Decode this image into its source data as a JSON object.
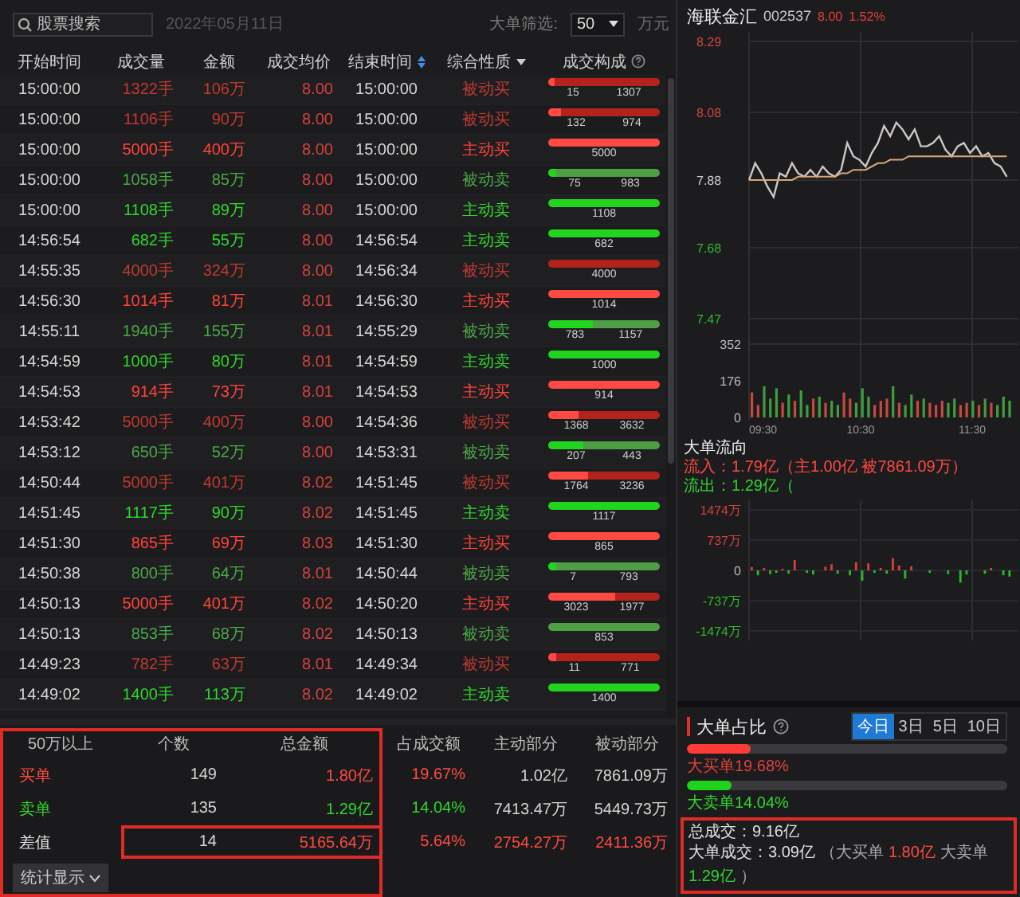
{
  "toolbar": {
    "search": {
      "placeholder": "股票搜索"
    },
    "date": "2022年05月11日",
    "filter_label": "大单筛选:",
    "filter_value": "50",
    "filter_unit": "万元"
  },
  "table": {
    "columns": [
      {
        "label": "开始时间",
        "sortable": false,
        "filter": false,
        "help": false
      },
      {
        "label": "成交量",
        "sortable": false,
        "filter": false,
        "help": false
      },
      {
        "label": "金额",
        "sortable": false,
        "filter": false,
        "help": false
      },
      {
        "label": "成交均价",
        "sortable": false,
        "filter": false,
        "help": false
      },
      {
        "label": "结束时间",
        "sortable": true,
        "filter": false,
        "help": false
      },
      {
        "label": "综合性质",
        "sortable": false,
        "filter": true,
        "help": false
      },
      {
        "label": "成交构成",
        "sortable": false,
        "filter": false,
        "help": true
      }
    ],
    "rows": [
      {
        "start": "15:00:00",
        "volume": "1322手",
        "amount": "106万",
        "avg_price": "8.00",
        "end": "15:00:00",
        "nature": "被动买",
        "kind": "buy",
        "active": false,
        "level": 0.06,
        "bar_labels": [
          "15",
          "1307"
        ]
      },
      {
        "start": "15:00:00",
        "volume": "1106手",
        "amount": "90万",
        "avg_price": "8.00",
        "end": "15:00:00",
        "nature": "被动买",
        "kind": "buy",
        "active": false,
        "level": 0.12,
        "bar_labels": [
          "132",
          "974"
        ]
      },
      {
        "start": "15:00:00",
        "volume": "5000手",
        "amount": "400万",
        "avg_price": "8.00",
        "end": "15:00:00",
        "nature": "主动买",
        "kind": "buy",
        "active": true,
        "level": 1,
        "bar_labels": [
          "5000"
        ]
      },
      {
        "start": "15:00:00",
        "volume": "1058手",
        "amount": "85万",
        "avg_price": "8.00",
        "end": "15:00:00",
        "nature": "被动卖",
        "kind": "sell",
        "active": false,
        "level": 0.07,
        "bar_labels": [
          "75",
          "983"
        ]
      },
      {
        "start": "15:00:00",
        "volume": "1108手",
        "amount": "89万",
        "avg_price": "8.00",
        "end": "15:00:00",
        "nature": "主动卖",
        "kind": "sell",
        "active": true,
        "level": 1,
        "bar_labels": [
          "1108"
        ]
      },
      {
        "start": "14:56:54",
        "volume": "682手",
        "amount": "55万",
        "avg_price": "8.00",
        "end": "14:56:54",
        "nature": "主动卖",
        "kind": "sell",
        "active": true,
        "level": 1,
        "bar_labels": [
          "682"
        ]
      },
      {
        "start": "14:55:35",
        "volume": "4000手",
        "amount": "324万",
        "avg_price": "8.00",
        "end": "14:56:34",
        "nature": "被动买",
        "kind": "buy",
        "active": false,
        "level": 0,
        "bar_labels": [
          "4000"
        ]
      },
      {
        "start": "14:56:30",
        "volume": "1014手",
        "amount": "81万",
        "avg_price": "8.01",
        "end": "14:56:30",
        "nature": "主动买",
        "kind": "buy",
        "active": true,
        "level": 1,
        "bar_labels": [
          "1014"
        ]
      },
      {
        "start": "14:55:11",
        "volume": "1940手",
        "amount": "155万",
        "avg_price": "8.01",
        "end": "14:55:29",
        "nature": "被动卖",
        "kind": "sell",
        "active": false,
        "level": 0.4,
        "bar_labels": [
          "783",
          "1157"
        ]
      },
      {
        "start": "14:54:59",
        "volume": "1000手",
        "amount": "80万",
        "avg_price": "8.01",
        "end": "14:54:59",
        "nature": "主动卖",
        "kind": "sell",
        "active": true,
        "level": 1,
        "bar_labels": [
          "1000"
        ]
      },
      {
        "start": "14:54:53",
        "volume": "914手",
        "amount": "73万",
        "avg_price": "8.01",
        "end": "14:54:53",
        "nature": "主动买",
        "kind": "buy",
        "active": true,
        "level": 1,
        "bar_labels": [
          "914"
        ]
      },
      {
        "start": "14:53:42",
        "volume": "5000手",
        "amount": "400万",
        "avg_price": "8.00",
        "end": "14:54:36",
        "nature": "被动买",
        "kind": "buy",
        "active": false,
        "level": 0.27,
        "bar_labels": [
          "1368",
          "3632"
        ]
      },
      {
        "start": "14:53:12",
        "volume": "650手",
        "amount": "52万",
        "avg_price": "8.00",
        "end": "14:53:31",
        "nature": "被动卖",
        "kind": "sell",
        "active": false,
        "level": 0.32,
        "bar_labels": [
          "207",
          "443"
        ]
      },
      {
        "start": "14:50:44",
        "volume": "5000手",
        "amount": "401万",
        "avg_price": "8.02",
        "end": "14:51:45",
        "nature": "被动买",
        "kind": "buy",
        "active": false,
        "level": 0.35,
        "bar_labels": [
          "1764",
          "3236"
        ]
      },
      {
        "start": "14:51:45",
        "volume": "1117手",
        "amount": "90万",
        "avg_price": "8.02",
        "end": "14:51:45",
        "nature": "主动卖",
        "kind": "sell",
        "active": true,
        "level": 1,
        "bar_labels": [
          "1117"
        ]
      },
      {
        "start": "14:51:30",
        "volume": "865手",
        "amount": "69万",
        "avg_price": "8.03",
        "end": "14:51:30",
        "nature": "主动买",
        "kind": "buy",
        "active": true,
        "level": 1,
        "bar_labels": [
          "865"
        ]
      },
      {
        "start": "14:50:38",
        "volume": "800手",
        "amount": "64万",
        "avg_price": "8.01",
        "end": "14:50:44",
        "nature": "被动卖",
        "kind": "sell",
        "active": false,
        "level": 0.07,
        "bar_labels": [
          "7",
          "793"
        ]
      },
      {
        "start": "14:50:13",
        "volume": "5000手",
        "amount": "401万",
        "avg_price": "8.02",
        "end": "14:50:20",
        "nature": "主动买",
        "kind": "buy",
        "active": true,
        "level": 0.6,
        "bar_labels": [
          "3023",
          "1977"
        ]
      },
      {
        "start": "14:50:13",
        "volume": "853手",
        "amount": "68万",
        "avg_price": "8.02",
        "end": "14:50:13",
        "nature": "被动卖",
        "kind": "sell",
        "active": false,
        "level": 0,
        "bar_labels": [
          "853"
        ]
      },
      {
        "start": "14:49:23",
        "volume": "782手",
        "amount": "63万",
        "avg_price": "8.01",
        "end": "14:49:34",
        "nature": "被动买",
        "kind": "buy",
        "active": false,
        "level": 0.07,
        "bar_labels": [
          "11",
          "771"
        ]
      },
      {
        "start": "14:49:02",
        "volume": "1400手",
        "amount": "113万",
        "avg_price": "8.02",
        "end": "14:49:02",
        "nature": "主动卖",
        "kind": "sell",
        "active": true,
        "level": 1,
        "bar_labels": [
          "1400"
        ]
      }
    ]
  },
  "summary": {
    "highlighted": true,
    "columns": [
      "50万以上",
      "个数",
      "总金额",
      "占成交额",
      "主动部分",
      "被动部分"
    ],
    "rows": [
      {
        "kind": "buy",
        "label": "买单",
        "count": "149",
        "total": "1.80亿",
        "share": "19.67%",
        "active": "1.02亿",
        "passive": "7861.09万",
        "highlighted": false
      },
      {
        "kind": "sell",
        "label": "卖单",
        "count": "135",
        "total": "1.29亿",
        "share": "14.04%",
        "active": "7413.47万",
        "passive": "5449.73万",
        "highlighted": false
      },
      {
        "kind": "diff",
        "label": "差值",
        "count": "14",
        "total": "5165.64万",
        "share": "5.64%",
        "active": "2754.27万",
        "passive": "2411.36万",
        "highlighted": true
      }
    ],
    "button": "统计显示"
  },
  "quote": {
    "name": "海联金汇",
    "code": "002537",
    "price": "8.00",
    "change": "1.52%"
  },
  "price_chart": {
    "chart_data": {
      "type": "line",
      "grid": true,
      "ylim": [
        7.47,
        8.29
      ],
      "yticks": [
        {
          "value": 8.29,
          "label": "8.29"
        },
        {
          "value": 8.08,
          "label": "8.08"
        },
        {
          "value": 7.88,
          "label": "7.88"
        },
        {
          "value": 7.68,
          "label": "7.68"
        },
        {
          "value": 7.47,
          "label": "7.47"
        }
      ],
      "series": [
        {
          "color": "#cfc6c6",
          "values": [
            7.88,
            7.93,
            7.9,
            7.86,
            7.83,
            7.9,
            7.89,
            7.93,
            7.9,
            7.89,
            7.91,
            7.89,
            7.92,
            7.9,
            7.89,
            7.91,
            7.99,
            7.95,
            7.94,
            7.92,
            7.96,
            7.99,
            8.04,
            8.01,
            8.05,
            8.03,
            8.0,
            8.03,
            7.98,
            7.98,
            7.99,
            8.01,
            7.97,
            7.95,
            7.98,
            7.99,
            7.96,
            7.98,
            7.95,
            7.96,
            7.93,
            7.92,
            7.89
          ]
        },
        {
          "color": "#d9a878",
          "values": [
            7.88,
            7.88,
            7.88,
            7.88,
            7.88,
            7.88,
            7.88,
            7.88,
            7.89,
            7.89,
            7.89,
            7.89,
            7.89,
            7.89,
            7.89,
            7.9,
            7.9,
            7.91,
            7.91,
            7.91,
            7.92,
            7.93,
            7.93,
            7.94,
            7.94,
            7.94,
            7.95,
            7.95,
            7.95,
            7.95,
            7.95,
            7.95,
            7.95,
            7.95,
            7.95,
            7.95,
            7.95,
            7.95,
            7.95,
            7.95,
            7.95,
            7.95,
            7.95
          ]
        }
      ]
    }
  },
  "volume_chart": {
    "time_labels": [
      "09:30",
      "10:30",
      "11:30"
    ],
    "chart_data": {
      "type": "bar",
      "grid": true,
      "ylim": [
        0,
        352
      ],
      "yticks": [
        {
          "value": 352,
          "label": "352"
        },
        {
          "value": 176,
          "label": "176"
        },
        {
          "value": 0,
          "label": "0"
        }
      ],
      "series": [
        {
          "values": [
            120,
            60,
            150,
            90,
            140,
            70,
            110,
            80,
            130,
            60,
            90,
            100,
            70,
            80,
            60,
            120,
            90,
            70,
            140,
            100,
            60,
            80,
            90,
            150,
            70,
            60,
            110,
            80,
            90,
            70,
            60,
            80,
            70,
            90,
            60,
            70,
            80,
            60,
            90,
            70,
            60,
            100,
            80
          ]
        }
      ]
    }
  },
  "flow": {
    "title": "大单流向",
    "inflow": "流入：1.79亿（主1.00亿 被7861.09万）",
    "outflow": "流出：1.29亿（",
    "chart_data": {
      "type": "bar",
      "grid": true,
      "ylim": [
        -1474,
        1474
      ],
      "yticks": [
        {
          "value": 1474,
          "label": "1474万"
        },
        {
          "value": 737,
          "label": "737万"
        },
        {
          "value": 0,
          "label": "0"
        },
        {
          "value": -737,
          "label": "-737万"
        },
        {
          "value": -1474,
          "label": "-1474万"
        }
      ],
      "series": [
        {
          "values": [
            80,
            -120,
            60,
            -90,
            -60,
            40,
            -80,
            250,
            0,
            -60,
            -100,
            0,
            90,
            150,
            -80,
            0,
            -120,
            200,
            -250,
            170,
            -60,
            60,
            -80,
            300,
            120,
            -200,
            100,
            0,
            0,
            -60,
            0,
            0,
            -90,
            0,
            -300,
            -100,
            0,
            0,
            -80,
            60,
            0,
            -120,
            -150
          ]
        }
      ]
    }
  },
  "ratio": {
    "title": "大单占比",
    "help": true,
    "periods": [
      {
        "label": "今日",
        "selected": true
      },
      {
        "label": "3日",
        "selected": false
      },
      {
        "label": "5日",
        "selected": false
      },
      {
        "label": "10日",
        "selected": false
      }
    ],
    "bars": [
      {
        "kind": "buy",
        "label": "大买单19.68%",
        "level": 0.197
      },
      {
        "kind": "sell",
        "label": "大卖单14.04%",
        "level": 0.14
      }
    ]
  },
  "totals": {
    "highlighted": true,
    "total": "总成交：9.16亿",
    "big": "大单成交：3.09亿",
    "detail_open": "（大买单",
    "big_buy": "1.80亿",
    "detail_mid": "大卖单",
    "big_sell": "1.29亿",
    "detail_close": "）"
  }
}
